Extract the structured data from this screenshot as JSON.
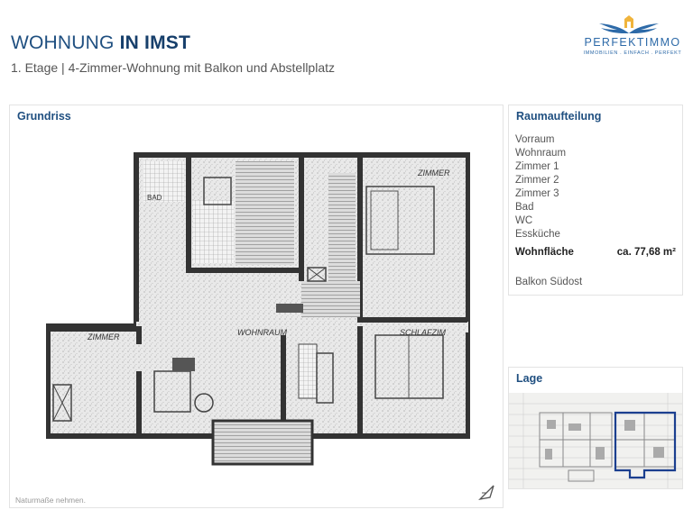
{
  "header": {
    "title_prefix": "WOHNUNG",
    "title_strong": "IN IMST",
    "subtitle": "1. Etage | 4-Zimmer-Wohnung mit Balkon und Abstellplatz"
  },
  "logo": {
    "name": "PERFEKTIMMO",
    "tagline": "IMMOBILIEN . EINFACH . PERFEKT",
    "icon": "wings-logo-icon",
    "color": "#2d6aa8"
  },
  "grundriss": {
    "title": "Grundriss",
    "footnote": "Naturmaße nehmen.",
    "room_labels": [
      "ZIMMER",
      "ZIMMER",
      "WOHNRAUM",
      "SCHLAFZIM",
      "BAD"
    ],
    "north_icon": "north-arrow-icon"
  },
  "raumaufteilung": {
    "title": "Raumaufteilung",
    "rooms": [
      "Vorraum",
      "Wohnraum",
      "Zimmer 1",
      "Zimmer 2",
      "Zimmer 3",
      "Bad",
      "WC",
      "Essküche"
    ],
    "area_label": "Wohnfläche",
    "area_value": "ca. 77,68 m²",
    "balkon": "Balkon Südost"
  },
  "lage": {
    "title": "Lage"
  },
  "colors": {
    "title": "#1f4f80",
    "accent": "#2d6aa8",
    "highlight": "#1b3f8f"
  }
}
